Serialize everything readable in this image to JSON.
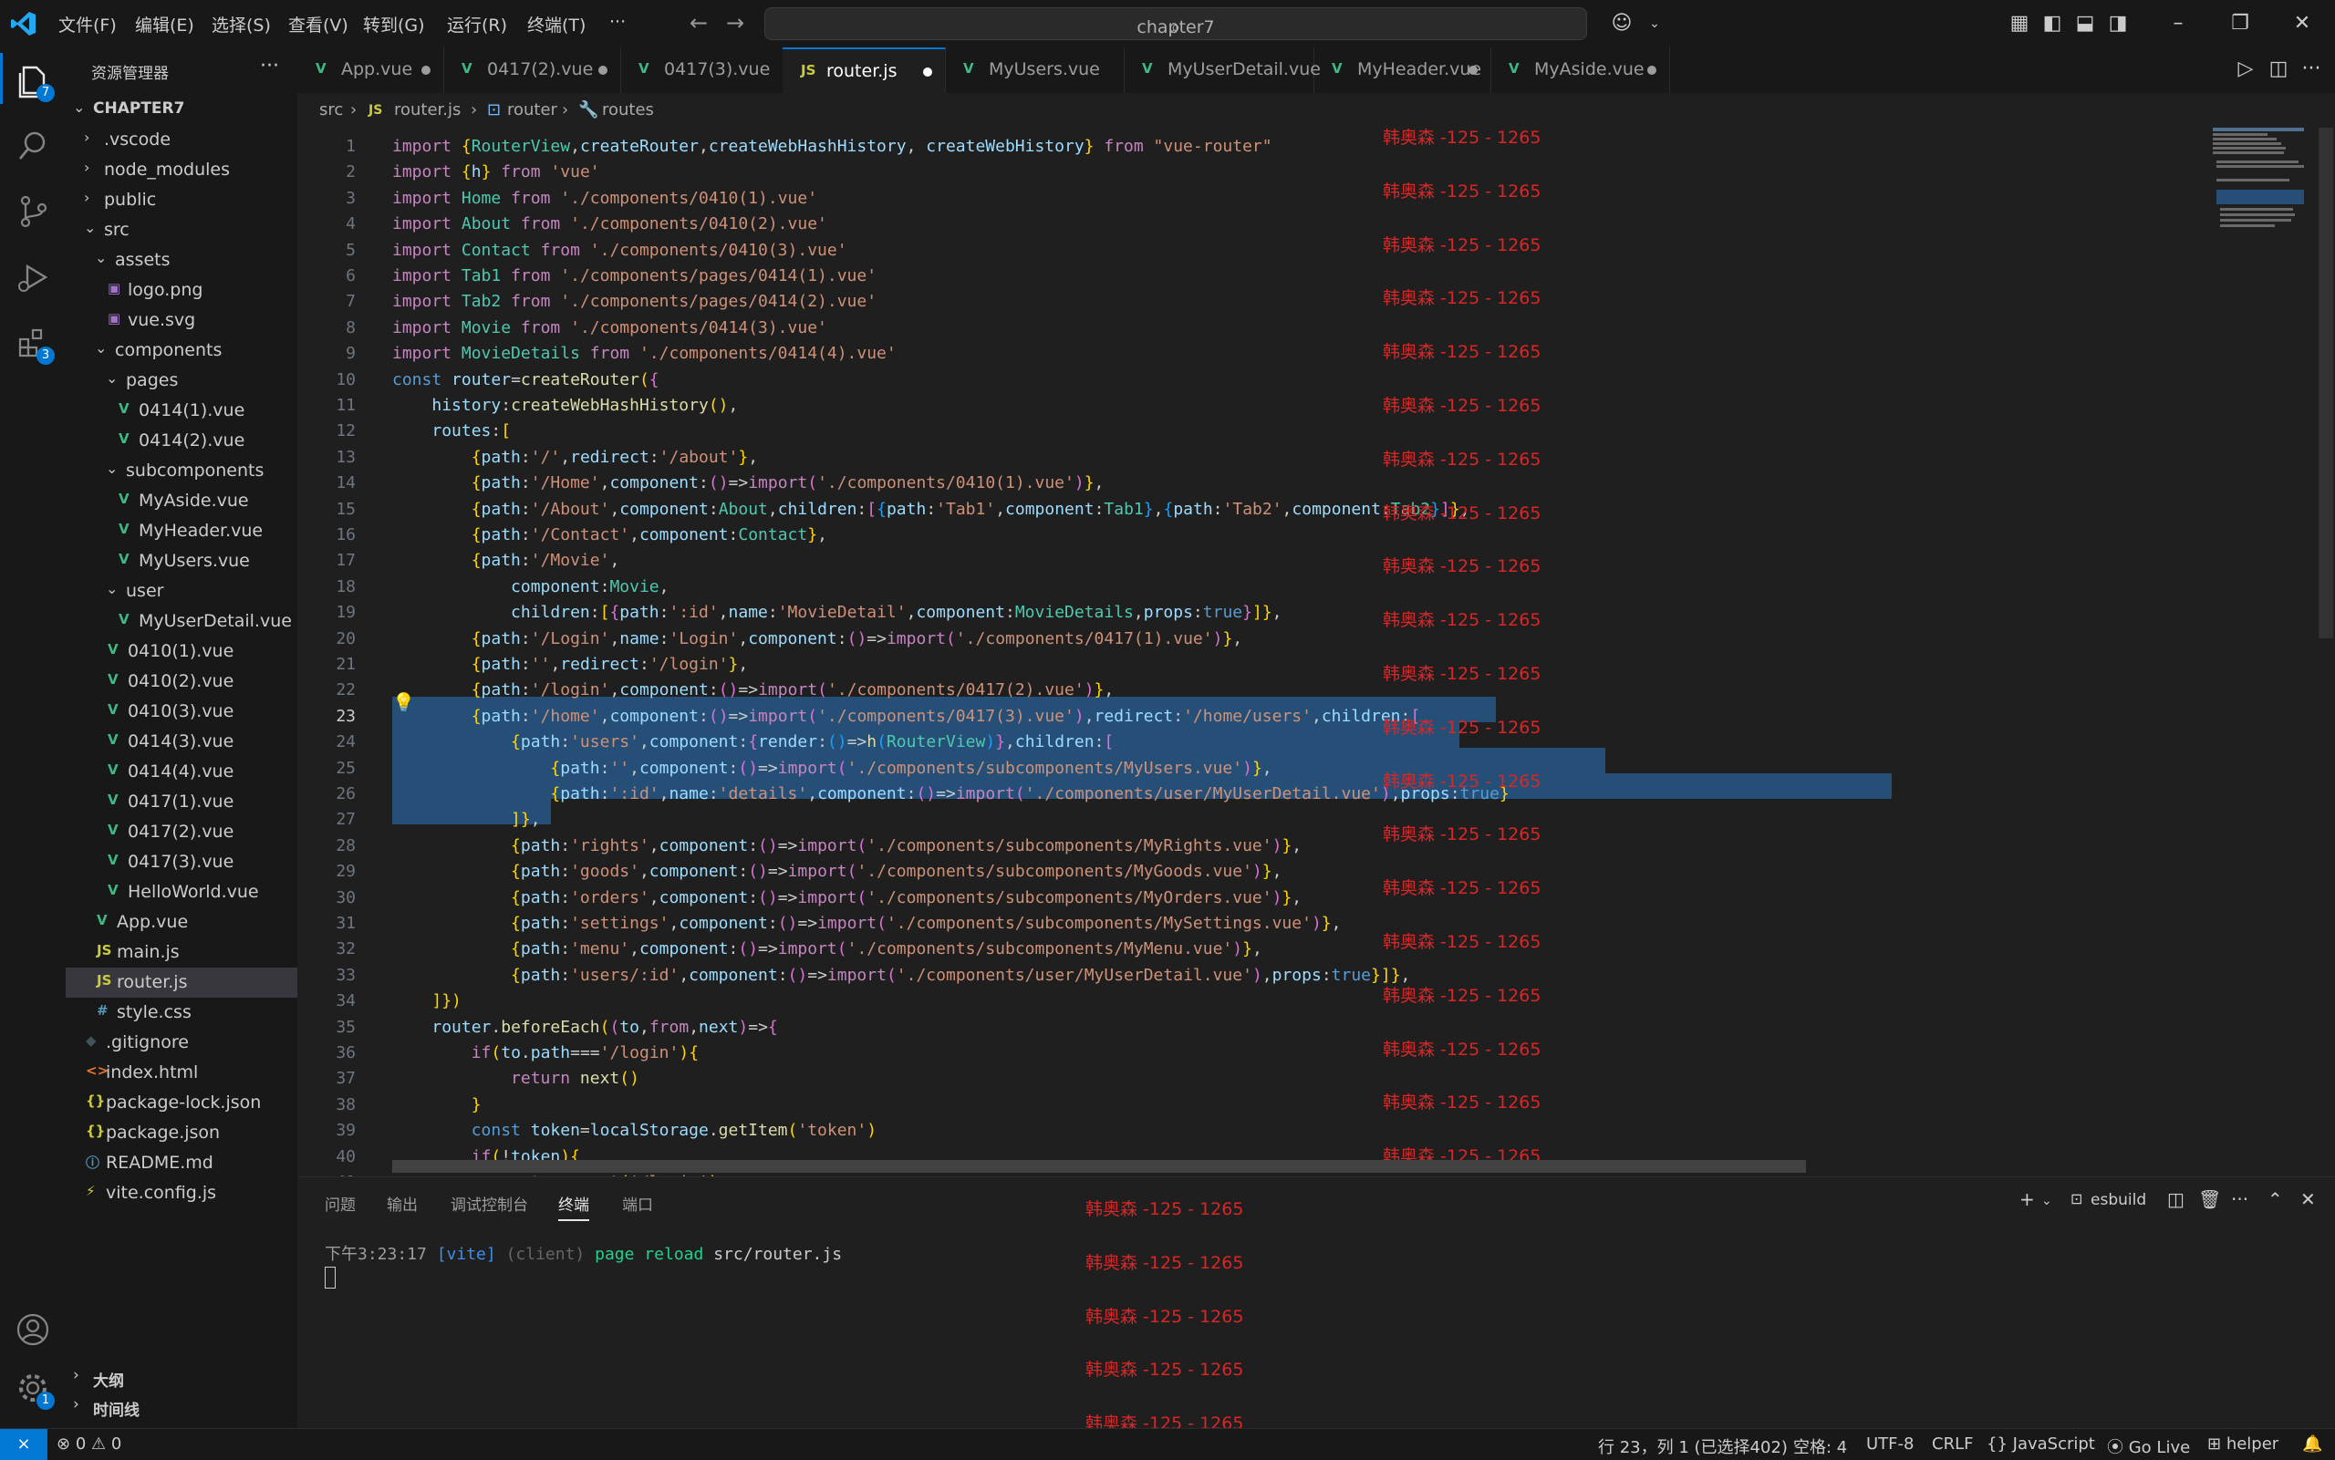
{
  "menu": [
    "文件(F)",
    "编辑(E)",
    "选择(S)",
    "查看(V)",
    "转到(G)",
    "运行(R)",
    "终端(T)",
    "···"
  ],
  "search": {
    "text": "chapter7"
  },
  "activity": {
    "explorer_badge": "7",
    "extensions_badge": "3",
    "settings_badge": "1"
  },
  "sidebar": {
    "title": "资源管理器",
    "more": "···",
    "root": "CHAPTER7",
    "tree": [
      {
        "label": ".vscode",
        "indent": 1,
        "chev": "›",
        "icon": ""
      },
      {
        "label": "node_modules",
        "indent": 1,
        "chev": "›",
        "icon": ""
      },
      {
        "label": "public",
        "indent": 1,
        "chev": "›",
        "icon": ""
      },
      {
        "label": "src",
        "indent": 1,
        "chev": "⌄",
        "icon": ""
      },
      {
        "label": "assets",
        "indent": 2,
        "chev": "⌄",
        "icon": ""
      },
      {
        "label": "logo.png",
        "indent": 3,
        "chev": "",
        "icon": "img"
      },
      {
        "label": "vue.svg",
        "indent": 3,
        "chev": "",
        "icon": "img"
      },
      {
        "label": "components",
        "indent": 2,
        "chev": "⌄",
        "icon": ""
      },
      {
        "label": "pages",
        "indent": 3,
        "chev": "⌄",
        "icon": ""
      },
      {
        "label": "0414(1).vue",
        "indent": 4,
        "chev": "",
        "icon": "vue"
      },
      {
        "label": "0414(2).vue",
        "indent": 4,
        "chev": "",
        "icon": "vue"
      },
      {
        "label": "subcomponents",
        "indent": 3,
        "chev": "⌄",
        "icon": ""
      },
      {
        "label": "MyAside.vue",
        "indent": 4,
        "chev": "",
        "icon": "vue"
      },
      {
        "label": "MyHeader.vue",
        "indent": 4,
        "chev": "",
        "icon": "vue"
      },
      {
        "label": "MyUsers.vue",
        "indent": 4,
        "chev": "",
        "icon": "vue"
      },
      {
        "label": "user",
        "indent": 3,
        "chev": "⌄",
        "icon": ""
      },
      {
        "label": "MyUserDetail.vue",
        "indent": 4,
        "chev": "",
        "icon": "vue"
      },
      {
        "label": "0410(1).vue",
        "indent": 3,
        "chev": "",
        "icon": "vue"
      },
      {
        "label": "0410(2).vue",
        "indent": 3,
        "chev": "",
        "icon": "vue"
      },
      {
        "label": "0410(3).vue",
        "indent": 3,
        "chev": "",
        "icon": "vue"
      },
      {
        "label": "0414(3).vue",
        "indent": 3,
        "chev": "",
        "icon": "vue"
      },
      {
        "label": "0414(4).vue",
        "indent": 3,
        "chev": "",
        "icon": "vue"
      },
      {
        "label": "0417(1).vue",
        "indent": 3,
        "chev": "",
        "icon": "vue"
      },
      {
        "label": "0417(2).vue",
        "indent": 3,
        "chev": "",
        "icon": "vue"
      },
      {
        "label": "0417(3).vue",
        "indent": 3,
        "chev": "",
        "icon": "vue"
      },
      {
        "label": "HelloWorld.vue",
        "indent": 3,
        "chev": "",
        "icon": "vue"
      },
      {
        "label": "App.vue",
        "indent": 2,
        "chev": "",
        "icon": "vue"
      },
      {
        "label": "main.js",
        "indent": 2,
        "chev": "",
        "icon": "js"
      },
      {
        "label": "router.js",
        "indent": 2,
        "chev": "",
        "icon": "js",
        "selected": true
      },
      {
        "label": "style.css",
        "indent": 2,
        "chev": "",
        "icon": "css"
      },
      {
        "label": ".gitignore",
        "indent": 1,
        "chev": "",
        "icon": "git"
      },
      {
        "label": "index.html",
        "indent": 1,
        "chev": "",
        "icon": "html"
      },
      {
        "label": "package-lock.json",
        "indent": 1,
        "chev": "",
        "icon": "json"
      },
      {
        "label": "package.json",
        "indent": 1,
        "chev": "",
        "icon": "json"
      },
      {
        "label": "README.md",
        "indent": 1,
        "chev": "",
        "icon": "info"
      },
      {
        "label": "vite.config.js",
        "indent": 1,
        "chev": "",
        "icon": "vite"
      }
    ],
    "outline": "大纲",
    "timeline": "时间线"
  },
  "tabs": [
    {
      "label": "App.vue",
      "icon": "vue",
      "dirty": true
    },
    {
      "label": "0417(2).vue",
      "icon": "vue",
      "dirty": true
    },
    {
      "label": "0417(3).vue",
      "icon": "vue",
      "dirty": false
    },
    {
      "label": "router.js",
      "icon": "js",
      "dirty": true,
      "active": true
    },
    {
      "label": "MyUsers.vue",
      "icon": "vue",
      "dirty": false
    },
    {
      "label": "MyUserDetail.vue",
      "icon": "vue",
      "dirty": false
    },
    {
      "label": "MyHeader.vue",
      "icon": "vue",
      "dirty": true
    },
    {
      "label": "MyAside.vue",
      "icon": "vue",
      "dirty": true
    }
  ],
  "breadcrumb": {
    "src": "src",
    "sep": "›",
    "file": "router.js",
    "router": "router",
    "routes": "routes"
  },
  "editor": {
    "current_line": 23,
    "watermark": "韩奥森 -125 - 1265",
    "lines": [
      "import {RouterView,createRouter,createWebHashHistory, createWebHistory} from \"vue-router\"",
      "import {h} from 'vue'",
      "import Home from './components/0410(1).vue'",
      "import About from './components/0410(2).vue'",
      "import Contact from './components/0410(3).vue'",
      "import Tab1 from './components/pages/0414(1).vue'",
      "import Tab2 from './components/pages/0414(2).vue'",
      "import Movie from './components/0414(3).vue'",
      "import MovieDetails from './components/0414(4).vue'",
      "const router=createRouter({",
      "    history:createWebHashHistory(),",
      "    routes:[",
      "        {path:'/',redirect:'/about'},",
      "        {path:'/Home',component:()=>import('./components/0410(1).vue')},",
      "        {path:'/About',component:About,children:[{path:'Tab1',component:Tab1},{path:'Tab2',component:Tab2}]},",
      "        {path:'/Contact',component:Contact},",
      "        {path:'/Movie',",
      "            component:Movie,",
      "            children:[{path:':id',name:'MovieDetail',component:MovieDetails,props:true}]},",
      "        {path:'/Login',name:'Login',component:()=>import('./components/0417(1).vue')},",
      "        {path:'',redirect:'/login'},",
      "        {path:'/login',component:()=>import('./components/0417(2).vue')},",
      "        {path:'/home',component:()=>import('./components/0417(3).vue'),redirect:'/home/users',children:[",
      "            {path:'users',component:{render:()=>h(RouterView)},children:[",
      "                {path:'',component:()=>import('./components/subcomponents/MyUsers.vue')},",
      "                {path:':id',name:'details',component:()=>import('./components/user/MyUserDetail.vue'),props:true}",
      "            ]},",
      "            {path:'rights',component:()=>import('./components/subcomponents/MyRights.vue')},",
      "            {path:'goods',component:()=>import('./components/subcomponents/MyGoods.vue')},",
      "            {path:'orders',component:()=>import('./components/subcomponents/MyOrders.vue')},",
      "            {path:'settings',component:()=>import('./components/subcomponents/MySettings.vue')},",
      "            {path:'menu',component:()=>import('./components/subcomponents/MyMenu.vue')},",
      "            {path:'users/:id',component:()=>import('./components/user/MyUserDetail.vue'),props:true}]},",
      "    ]})",
      "    router.beforeEach((to,from,next)=>{",
      "        if(to.path==='/login'){",
      "            return next()",
      "        }",
      "        const token=localStorage.getItem('token')",
      "        if(!token){",
      "            return next('/login')"
    ]
  },
  "panel": {
    "tabs": [
      "问题",
      "输出",
      "调试控制台",
      "终端",
      "端口"
    ],
    "active_tab": "终端",
    "terminal_name": "esbuild",
    "terminal_time": "下午3:23:17",
    "terminal_tag": "[vite]",
    "terminal_client": "(client)",
    "terminal_msg": "page reload",
    "terminal_path": "src/router.js"
  },
  "status": {
    "errors": "0",
    "warnings": "0",
    "position": "行 23，列 1 (已选择402)",
    "spaces": "空格: 4",
    "encoding": "UTF-8",
    "eol": "CRLF",
    "language": "JavaScript",
    "golive": "Go Live",
    "helper": "helper"
  }
}
